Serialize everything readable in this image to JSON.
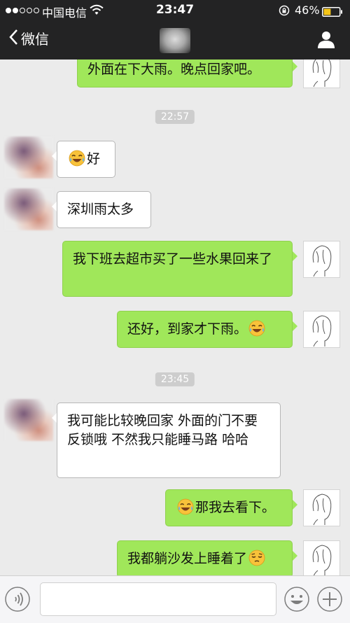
{
  "status_bar": {
    "carrier": "中国电信",
    "time": "23:47",
    "battery": "46%",
    "battery_level": 0.46,
    "signal_bars_filled": 2,
    "signal_bars_total": 5,
    "icons": [
      "wifi-icon",
      "orientation-lock-icon",
      "battery-icon"
    ]
  },
  "nav": {
    "back_label": "微信",
    "icons": [
      "chevron-left-icon",
      "profile-icon"
    ]
  },
  "messages": [
    {
      "type": "out",
      "text": "外面在下大雨。晚点回家吧。"
    },
    {
      "type": "time",
      "text": "22:57"
    },
    {
      "type": "in",
      "text": "好",
      "emoji": "laugh-cry-emoji"
    },
    {
      "type": "in",
      "text": "深圳雨太多"
    },
    {
      "type": "out",
      "text": "我下班去超市买了一些水果回来了"
    },
    {
      "type": "out",
      "text": "还好，到家才下雨。",
      "emoji": "laugh-cry-emoji"
    },
    {
      "type": "time",
      "text": "23:45"
    },
    {
      "type": "in",
      "text": "我可能比较晚回家 外面的门不要反锁哦 不然我只能睡马路 哈哈"
    },
    {
      "type": "out",
      "text": "那我去看下。",
      "emoji": "laugh-cry-emoji"
    },
    {
      "type": "out",
      "text": "我都躺沙发上睡着了",
      "emoji": "pensive-emoji"
    }
  ],
  "input": {
    "value": "",
    "icons": [
      "voice-icon",
      "emoji-icon",
      "plus-icon"
    ]
  },
  "colors": {
    "top_bar": "#232324",
    "chat_background": "#ebebeb",
    "outgoing_bubble": "#a0e75a",
    "incoming_bubble": "#ffffff",
    "timestamp_pill": "#cdcdcd",
    "battery_fill": "#f5c518"
  }
}
